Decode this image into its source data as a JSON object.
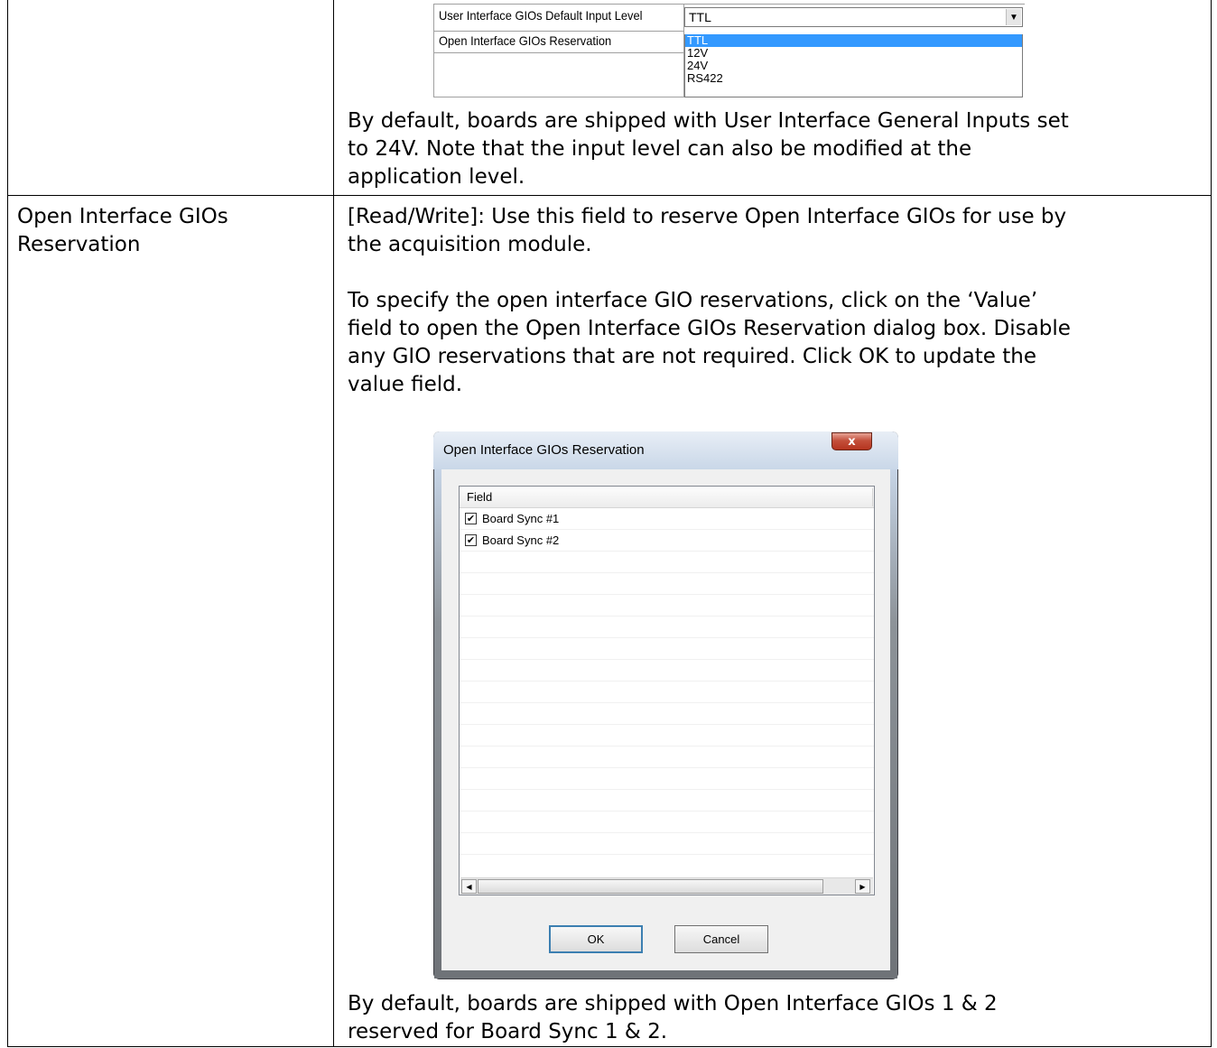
{
  "property_grid": {
    "rows": [
      {
        "name": "User Interface GIOs Default Input Level",
        "value": "TTL"
      },
      {
        "name": "Open Interface GIOs Reservation",
        "value": ""
      }
    ],
    "dropdown_options": [
      "TTL",
      "12V",
      "24V",
      "RS422"
    ],
    "selected_option": "TTL"
  },
  "section1": {
    "default_note_line1": "By default, boards are shipped with User Interface General Inputs set",
    "default_note_line2": "to 24V. Note that the input level can also be modified at the",
    "default_note_line3": "application level."
  },
  "section2": {
    "term_line1": "Open Interface GIOs",
    "term_line2": "Reservation",
    "desc_line1": "[Read/Write]: Use this field to reserve Open Interface GIOs for use by",
    "desc_line2": "the acquisition module.",
    "instr_line1": "To specify the open interface GIO reservations, click on the ‘Value’",
    "instr_line2": "field to open the Open Interface GIOs Reservation dialog box. Disable",
    "instr_line3": "any GIO reservations that are not required. Click OK to update the",
    "instr_line4": "value field.",
    "default_line1": "By default, boards are shipped with Open Interface GIOs 1 & 2",
    "default_line2": "reserved for Board Sync 1 & 2."
  },
  "dialog": {
    "title": "Open Interface GIOs Reservation",
    "close_glyph": "x",
    "column_header": "Field",
    "items": [
      {
        "label": "Board Sync #1",
        "checked": true
      },
      {
        "label": "Board Sync #2",
        "checked": true
      }
    ],
    "ok_label": "OK",
    "cancel_label": "Cancel"
  }
}
